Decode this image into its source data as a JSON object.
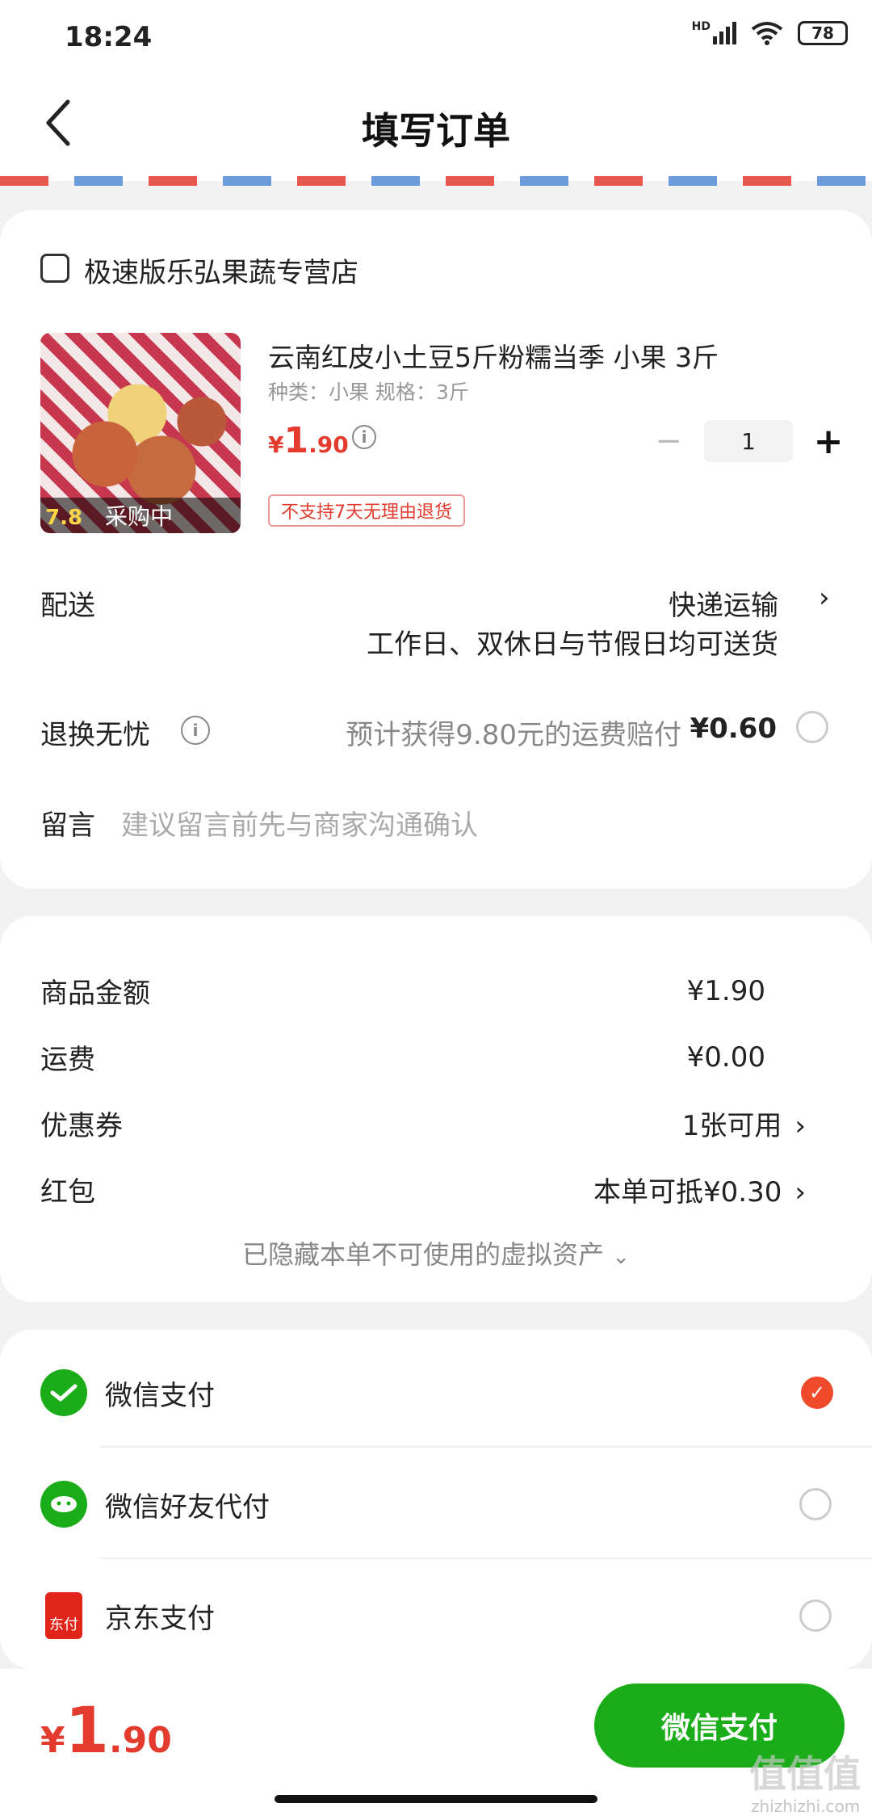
{
  "status": {
    "time": "18:24",
    "battery": "78",
    "network": "HD"
  },
  "nav": {
    "title": "填写订单"
  },
  "shop": {
    "name": "极速版乐弘果蔬专营店"
  },
  "product": {
    "name": "云南红皮小土豆5斤粉糯当季 小果 3斤",
    "spec": "种类：小果   规格：3斤",
    "price_symbol": "¥",
    "price_int": "1",
    "price_dec": ".90",
    "quantity": "1",
    "no_return": "不支持7天无理由退货",
    "thumb_price": "7.8",
    "thumb_tag": "采购中"
  },
  "delivery": {
    "label": "配送",
    "value": "快递运输",
    "sub": "工作日、双休日与节假日均可送货"
  },
  "return_service": {
    "label": "退换无忧",
    "text": "预计获得9.80元的运费赔付",
    "price": "¥0.60"
  },
  "message": {
    "label": "留言",
    "placeholder": "建议留言前先与商家沟通确认"
  },
  "summary": {
    "goods_label": "商品金额",
    "goods_value": "¥1.90",
    "shipping_label": "运费",
    "shipping_value": "¥0.00",
    "coupon_label": "优惠券",
    "coupon_value": "1张可用",
    "redpacket_label": "红包",
    "redpacket_value": "本单可抵¥0.30",
    "hidden_assets": "已隐藏本单不可使用的虚拟资产"
  },
  "payment": {
    "options": [
      {
        "label": "微信支付",
        "selected": true
      },
      {
        "label": "微信好友代付",
        "selected": false
      },
      {
        "label": "京东支付",
        "selected": false
      }
    ],
    "jd_icon_text": "东付"
  },
  "bottom": {
    "total_symbol": "¥",
    "total_int": "1",
    "total_dec": ".90",
    "pay_button": "微信支付"
  },
  "watermark": {
    "text": "值值值",
    "sub": "zhizhizhi.com"
  },
  "colors": {
    "accent_red": "#e33b2e",
    "wechat_green": "#1aad19",
    "radio_selected": "#f04a2d"
  }
}
